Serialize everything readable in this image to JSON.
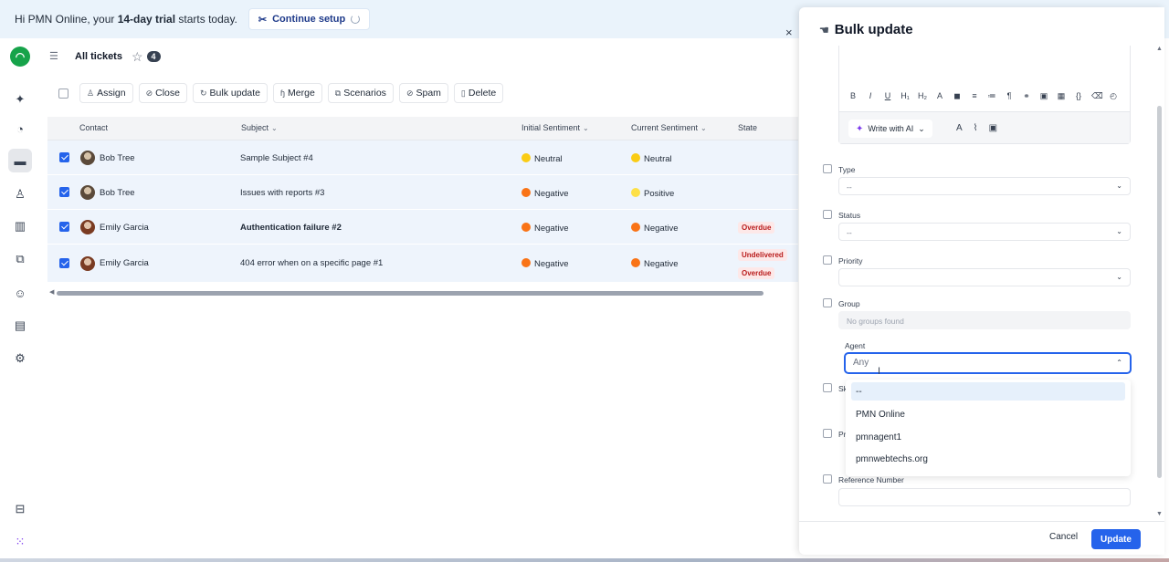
{
  "banner": {
    "prefix": "Hi PMN Online, your ",
    "trial": "14-day trial",
    "suffix": " starts today.",
    "setup_label": "Continue setup"
  },
  "sidebar": {
    "items": [
      "home-icon",
      "compass-icon",
      "tickets-icon",
      "contacts-icon",
      "knowledge-icon",
      "chats-icon",
      "bot-icon",
      "reports-icon",
      "settings-icon",
      "collapse-icon",
      "apps-icon"
    ]
  },
  "view": {
    "title": "All tickets",
    "count": "4"
  },
  "toolbar": {
    "assign": "Assign",
    "close": "Close",
    "bulk_update": "Bulk update",
    "merge": "Merge",
    "scenarios": "Scenarios",
    "spam": "Spam",
    "delete": "Delete"
  },
  "table": {
    "headers": {
      "contact": "Contact",
      "subject": "Subject",
      "initial": "Initial Sentiment",
      "current": "Current Sentiment",
      "state": "State"
    },
    "rows": [
      {
        "contact": "Bob Tree",
        "subject": "Sample Subject #4",
        "initial": "Neutral",
        "current": "Neutral",
        "state": []
      },
      {
        "contact": "Bob Tree",
        "subject": "Issues with reports #3",
        "initial": "Negative",
        "current": "Positive",
        "state": []
      },
      {
        "contact": "Emily Garcia",
        "subject": "Authentication failure #2",
        "initial": "Negative",
        "current": "Negative",
        "state": [
          "Overdue"
        ]
      },
      {
        "contact": "Emily Garcia",
        "subject": "404 error when on a specific page #1",
        "initial": "Negative",
        "current": "Negative",
        "state": [
          "Undelivered",
          "Overdue"
        ]
      }
    ]
  },
  "panel": {
    "title": "Bulk update",
    "write_ai": "Write with AI",
    "type_label": "Type",
    "type_value": "--",
    "status_label": "Status",
    "status_value": "--",
    "priority_label": "Priority",
    "group_label": "Group",
    "group_value": "No groups found",
    "agent_label": "Agent",
    "agent_placeholder": "Any",
    "agent_options": [
      "--",
      "PMN Online",
      "pmnagent1",
      "pmnwebtechs.org"
    ],
    "partial_1": "Sk",
    "partial_2": "Pr",
    "reference_label": "Reference Number",
    "cancel": "Cancel",
    "update": "Update"
  },
  "colors": {
    "primary": "#2563eb",
    "row_selected": "#eef4fc",
    "overdue": "#b91c1c"
  }
}
